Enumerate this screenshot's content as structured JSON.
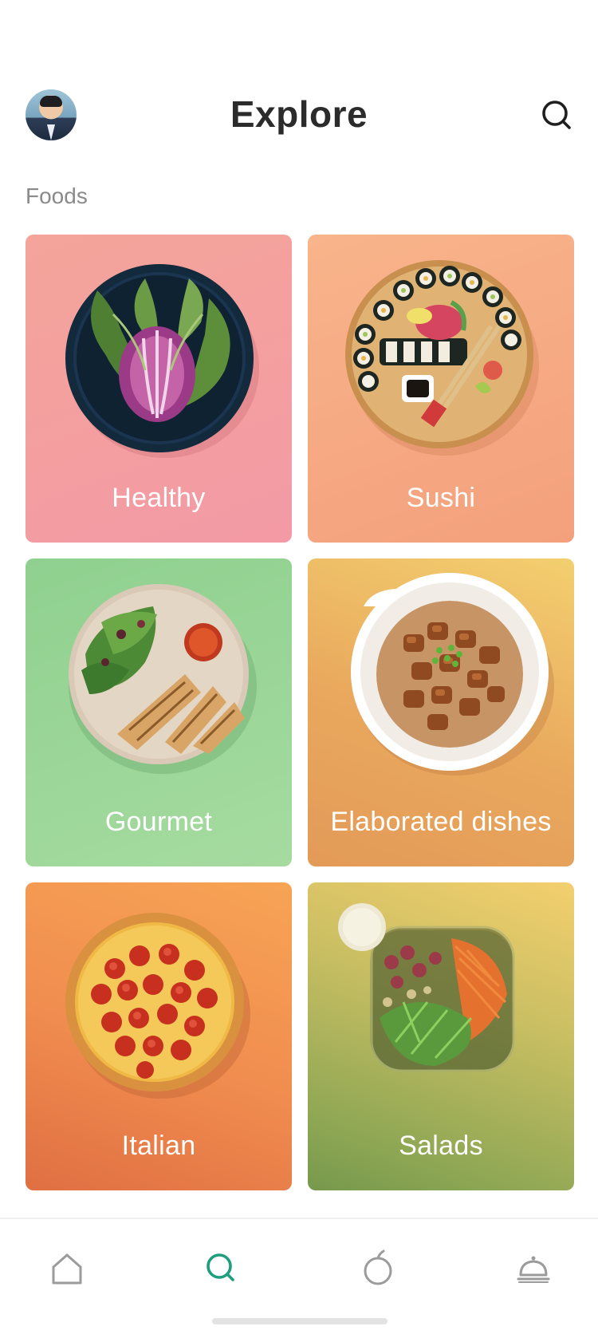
{
  "header": {
    "title": "Explore",
    "avatar_icon": "user-avatar",
    "search_icon": "search-icon"
  },
  "section": {
    "label": "Foods"
  },
  "categories": [
    {
      "label": "Healthy",
      "icon": "lettuce-bowl-image"
    },
    {
      "label": "Sushi",
      "icon": "sushi-platter-image"
    },
    {
      "label": "Gourmet",
      "icon": "grilled-chicken-plate-image"
    },
    {
      "label": "Elaborated dishes",
      "icon": "chicken-rice-bowl-image"
    },
    {
      "label": "Italian",
      "icon": "pepperoni-pizza-image"
    },
    {
      "label": "Salads",
      "icon": "salad-container-image"
    }
  ],
  "tabbar": {
    "items": [
      {
        "icon": "home-icon",
        "active": false
      },
      {
        "icon": "search-icon",
        "active": true
      },
      {
        "icon": "apple-icon",
        "active": false
      },
      {
        "icon": "cloche-icon",
        "active": false
      }
    ],
    "active_color": "#1f9e7d",
    "inactive_color": "#9b9b9b"
  }
}
